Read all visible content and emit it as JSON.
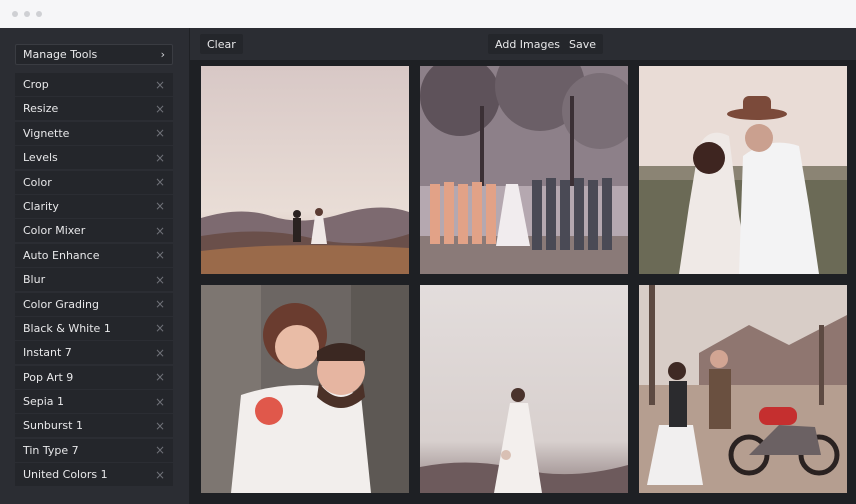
{
  "sidebar": {
    "manage_tools_label": "Manage Tools",
    "tools": [
      "Crop",
      "Resize",
      "Vignette",
      "Levels",
      "Color",
      "Clarity",
      "Color Mixer",
      "Auto Enhance",
      "Blur",
      "Color Grading",
      "Black & White 1",
      "Instant 7",
      "Pop Art 9",
      "Sepia 1",
      "Sunburst 1",
      "Tin Type 7",
      "United Colors 1"
    ]
  },
  "toolbar": {
    "clear_label": "Clear",
    "add_images_label": "Add Images",
    "save_label": "Save"
  },
  "icons": {
    "remove": "close-icon",
    "manage_tools": "chevron-right-icon"
  },
  "colors": {
    "app_background": "#2b2d33",
    "panel": "#24262b",
    "canvas": "#1e2024",
    "text": "#e8e8ea"
  }
}
